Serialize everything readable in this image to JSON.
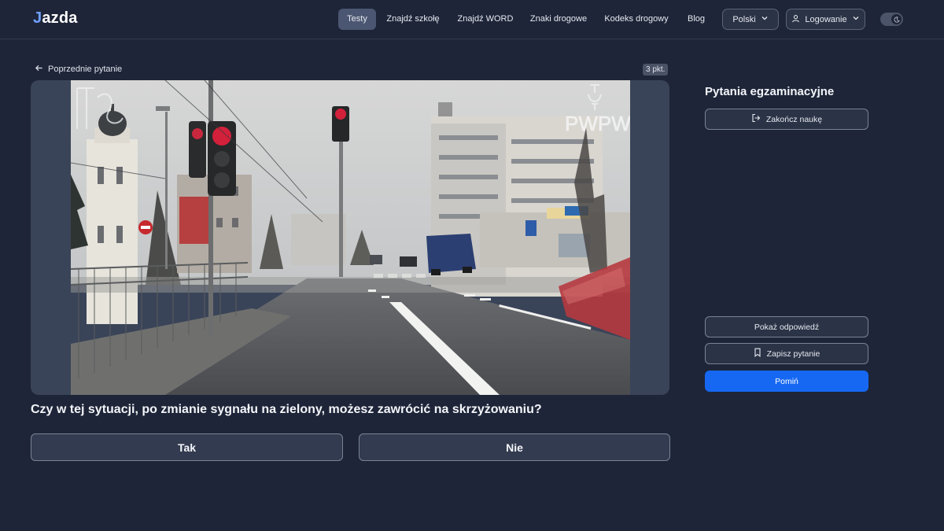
{
  "header": {
    "logo_mark": "J",
    "logo_text": "azda",
    "nav": [
      {
        "label": "Testy",
        "active": true
      },
      {
        "label": "Znajdź szkołę",
        "active": false
      },
      {
        "label": "Znajdź WORD",
        "active": false
      },
      {
        "label": "Znaki drogowe",
        "active": false
      },
      {
        "label": "Kodeks drogowy",
        "active": false
      },
      {
        "label": "Blog",
        "active": false
      }
    ],
    "language_select": "Polski",
    "login_label": "Logowanie",
    "theme_toggle_icon": "moon-icon"
  },
  "main": {
    "back_label": "Poprzednie pytanie",
    "points_badge": "3 pkt.",
    "scene_watermark": "PWPW",
    "question": "Czy w tej sytuacji, po zmianie sygnału na zielony, możesz zawrócić na skrzyżowaniu?",
    "answers": [
      "Tak",
      "Nie"
    ]
  },
  "sidebar": {
    "title": "Pytania egzaminacyjne",
    "end_label": "Zakończ naukę",
    "show_answer_label": "Pokaż odpowiedź",
    "save_label": "Zapisz pytanie",
    "skip_label": "Pomiń"
  },
  "colors": {
    "background": "#1e2538",
    "accent": "#1668f2",
    "active_nav": "#4b5772",
    "logo_accent": "#6ea0ff"
  }
}
